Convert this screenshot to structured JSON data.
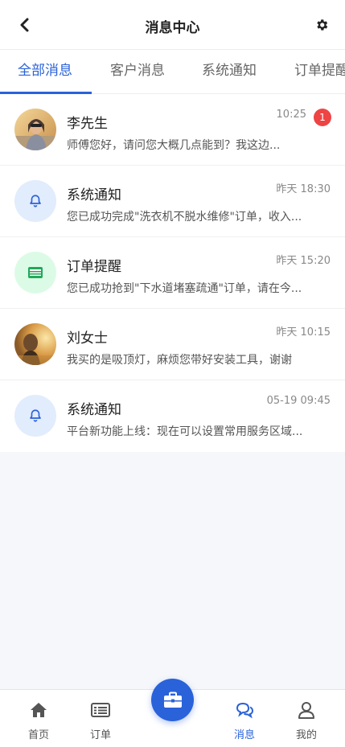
{
  "header": {
    "title": "消息中心",
    "back_icon": "chevron-left-icon",
    "settings_icon": "gear-icon"
  },
  "tabs": [
    {
      "label": "全部消息",
      "active": true
    },
    {
      "label": "客户消息",
      "active": false
    },
    {
      "label": "系统通知",
      "active": false
    },
    {
      "label": "订单提醒",
      "active": false
    }
  ],
  "messages": [
    {
      "name": "李先生",
      "time": "10:25",
      "badge": "1",
      "preview": "师傅您好，请问您大概几点能到？我这边...",
      "avatar": "photo-woman-sunglasses"
    },
    {
      "name": "系统通知",
      "time": "昨天 18:30",
      "preview": "您已成功完成\"洗衣机不脱水维修\"订单，收入...",
      "avatar": "bell-icon"
    },
    {
      "name": "订单提醒",
      "time": "昨天 15:20",
      "preview": "您已成功抢到\"下水道堵塞疏通\"订单，请在今...",
      "avatar": "list-card-icon"
    },
    {
      "name": "刘女士",
      "time": "昨天 10:15",
      "preview": "我买的是吸顶灯，麻烦您带好安装工具，谢谢",
      "avatar": "photo-woman-field"
    },
    {
      "name": "系统通知",
      "time": "05-19 09:45",
      "preview": "平台新功能上线：现在可以设置常用服务区域...",
      "avatar": "bell-icon"
    }
  ],
  "bottom_nav": [
    {
      "label": "首页",
      "icon": "home-icon",
      "active": false
    },
    {
      "label": "订单",
      "icon": "order-list-icon",
      "active": false
    },
    {
      "label": "消息",
      "icon": "chat-icon",
      "active": true
    },
    {
      "label": "我的",
      "icon": "user-icon",
      "active": false
    }
  ],
  "fab_icon": "briefcase-icon",
  "colors": {
    "accent": "#2a62d9",
    "badge": "#ee4444",
    "bell_bg": "#e1ecfd",
    "order_bg": "#dcfbe6"
  }
}
